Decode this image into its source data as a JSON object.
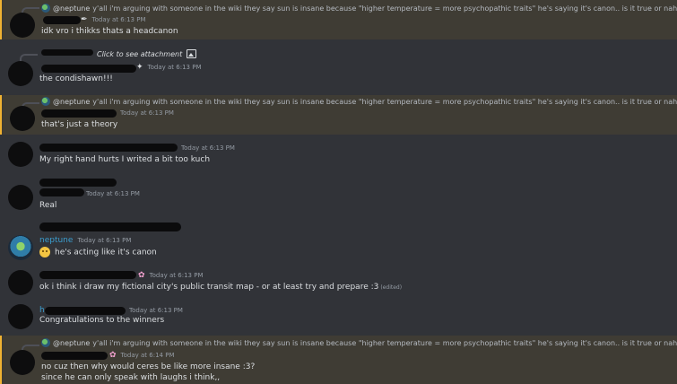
{
  "colors": {
    "background": "#313338",
    "mention_highlight": "#3f3c34",
    "mention_border": "#f0b232",
    "username": "#3b9dce"
  },
  "reply_quote": {
    "author": "@neptune",
    "text": "y'all i'm arguing with someone in the wiki they say sun is insane because \"higher temperature = more psychopathic traits\" he's saying it's canon.. is it true or nah"
  },
  "messages": [
    {
      "timestamp": "Today at 6:13 PM",
      "lines": [
        "idk vro i thikks thats a headcanon"
      ]
    },
    {
      "reply_attachment": "Click to see attachment",
      "timestamp": "Today at 6:13 PM",
      "lines": [
        "the condishawn!!!"
      ]
    },
    {
      "timestamp": "Today at 6:13 PM",
      "lines": [
        "that's just a theory"
      ]
    },
    {
      "timestamp": "Today at 6:13 PM",
      "lines": [
        "My right hand hurts I writed a bit too kuch"
      ]
    },
    {
      "timestamp": "Today at 6:13 PM",
      "lines": [
        "Real"
      ]
    },
    {
      "username": "neptune",
      "timestamp": "Today at 6:13 PM",
      "lines": [
        "he's acting like it's canon"
      ],
      "emoji": "weary-face-emoji"
    },
    {
      "timestamp": "Today at 6:13 PM",
      "lines": [
        "ok i think i draw my fictional city's public transit map - or at least try and prepare :3"
      ],
      "edited": "(edited)"
    },
    {
      "username_fragment": "h",
      "timestamp": "Today at 6:13 PM",
      "lines": [
        "Congratulations to the winners"
      ]
    },
    {
      "timestamp": "Today at 6:14 PM",
      "lines": [
        "no cuz then why would ceres be like more insane :3?",
        "since he can only speak with laughs i think,,"
      ]
    }
  ]
}
